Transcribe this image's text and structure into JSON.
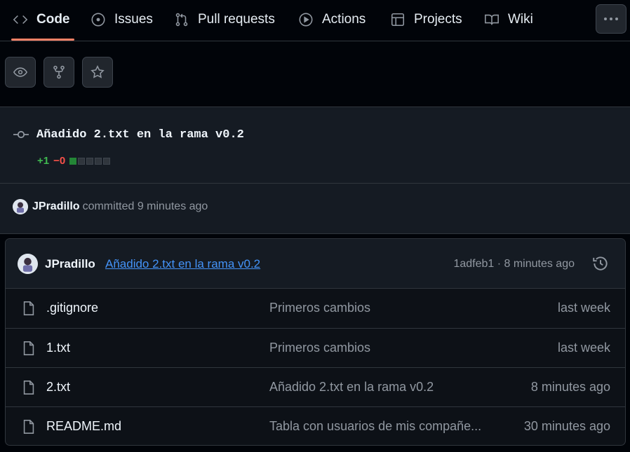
{
  "nav": {
    "tabs": [
      {
        "label": "Code",
        "icon": "code-icon"
      },
      {
        "label": "Issues",
        "icon": "issue-opened-icon"
      },
      {
        "label": "Pull requests",
        "icon": "git-pull-request-icon"
      },
      {
        "label": "Actions",
        "icon": "play-icon"
      },
      {
        "label": "Projects",
        "icon": "table-icon"
      },
      {
        "label": "Wiki",
        "icon": "book-icon"
      }
    ],
    "active_tab": "Code",
    "more_icon": "kebab-horizontal-icon"
  },
  "repo_actions": {
    "icons": [
      "eye-icon",
      "repo-forked-icon",
      "star-icon"
    ]
  },
  "commit": {
    "title": "Añadido 2.txt en la rama v0.2",
    "additions": "+1",
    "deletions": "−0",
    "diffstat": {
      "added_blocks": 1,
      "total_blocks": 5
    },
    "author": "JPradillo",
    "committed_text": "committed 9 minutes ago"
  },
  "file_box": {
    "header": {
      "author": "JPradillo",
      "message": "Añadido 2.txt en la rama v0.2",
      "sha_and_time": "1adfeb1 · 8 minutes ago",
      "history_icon": "history-icon"
    },
    "files": [
      {
        "name": ".gitignore",
        "message": "Primeros cambios",
        "time": "last week"
      },
      {
        "name": "1.txt",
        "message": "Primeros cambios",
        "time": "last week"
      },
      {
        "name": "2.txt",
        "message": "Añadido 2.txt en la rama v0.2",
        "time": "8 minutes ago"
      },
      {
        "name": "README.md",
        "message": "Tabla con usuarios de mis compañe...",
        "time": "30 minutes ago"
      }
    ]
  },
  "colors": {
    "background": "#010409",
    "panel": "#151b23",
    "accent_underline": "#f78166",
    "link": "#4493f8",
    "additions": "#3fb950",
    "deletions": "#f85149"
  }
}
